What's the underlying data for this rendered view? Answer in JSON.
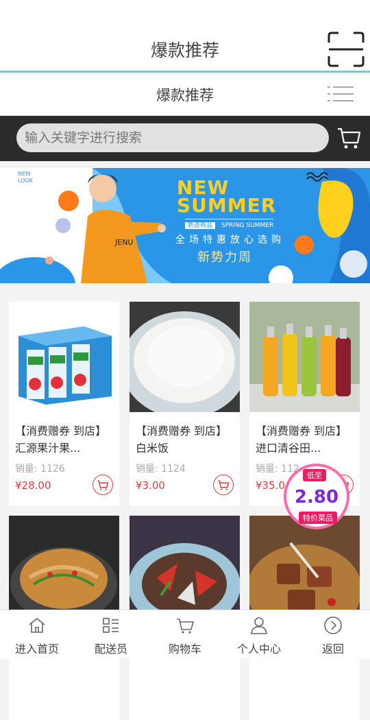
{
  "header": {
    "title": "爆款推荐"
  },
  "subheader": {
    "title": "爆款推荐"
  },
  "search": {
    "placeholder": "输入关键字进行搜索"
  },
  "banner": {
    "side_text_1": "NEW",
    "side_text_2": "LOOK",
    "headline_1": "NEW",
    "headline_2": "SUMMER",
    "tag_left": "新选商品",
    "tag_right": "SPRING SUMMER",
    "line1": "全场特惠放心选购",
    "line2": "新势力周"
  },
  "products": [
    {
      "name": "【消费赠券 到店】汇源果汁果...",
      "sales": "销量: 1126",
      "price": "¥28.00"
    },
    {
      "name": "【消费赠券 到店】白米饭",
      "sales": "销量: 1124",
      "price": "¥3.00"
    },
    {
      "name": "【消费赠券 到店】进口清谷田...",
      "sales": "销量: 112",
      "price": "¥35.0"
    },
    {
      "name": "",
      "sales": "",
      "price": ""
    },
    {
      "name": "",
      "sales": "",
      "price": ""
    },
    {
      "name": "",
      "sales": "",
      "price": ""
    }
  ],
  "promo_badge": {
    "top": "低至",
    "value": "2.80",
    "bottom": "特价菜品"
  },
  "tabs": [
    {
      "label": "进入首页",
      "icon": "home-icon"
    },
    {
      "label": "配送员",
      "icon": "list-icon"
    },
    {
      "label": "购物车",
      "icon": "cart-icon"
    },
    {
      "label": "个人中心",
      "icon": "user-icon"
    },
    {
      "label": "返回",
      "icon": "back-icon"
    }
  ],
  "colors": {
    "accent": "#7fc6c6",
    "price": "#e23a3a",
    "searchbar": "#2b2b2b"
  }
}
